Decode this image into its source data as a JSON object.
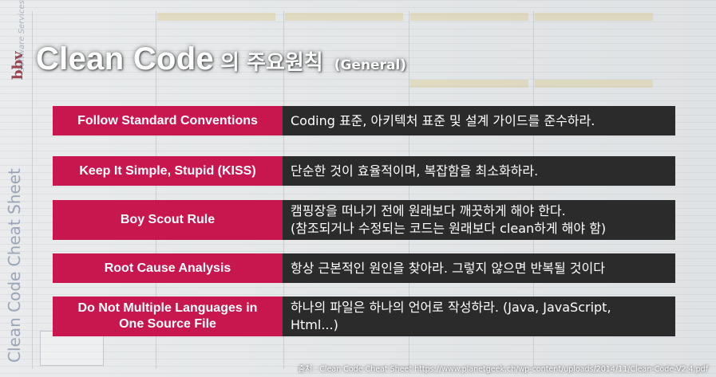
{
  "slide": {
    "title_main": "Clean Code",
    "title_korean": "의 주요원칙",
    "title_paren": "(General)",
    "source": "출처 : Clean Code Cheat Sheet https://www.planetgeek.ch/wp-content/uploads/2014/11/Clean-Code-V2.4.pdf"
  },
  "principles": [
    {
      "name": "Follow Standard Conventions",
      "lines": [
        "Coding 표준, 아키텍처 표준 및 설계 가이드를 준수하라."
      ]
    },
    {
      "name": "Keep It Simple, Stupid (KISS)",
      "lines": [
        "단순한 것이 효율적이며, 복잡함을 최소화하라."
      ]
    },
    {
      "name": "Boy Scout Rule",
      "lines": [
        "캠핑장을 떠나기 전에 원래보다 깨끗하게 해야 한다.",
        "(참조되거나 수정되는 코드는 원래보다 clean하게 해야 함)"
      ]
    },
    {
      "name": "Root Cause Analysis",
      "lines": [
        "항상 근본적인 원인을 찾아라. 그렇지 않으면 반복될 것이다"
      ]
    },
    {
      "name_lines": [
        "Do Not Multiple Languages in",
        "One Source File"
      ],
      "lines": [
        "하나의 파일은 하나의 언어로 작성하라. (Java, JavaScript,",
        "Html...)"
      ]
    }
  ],
  "background": {
    "logo": "bbv",
    "sheet_title": "Clean Code Cheat Sheet",
    "subtitle": "Software Services"
  }
}
